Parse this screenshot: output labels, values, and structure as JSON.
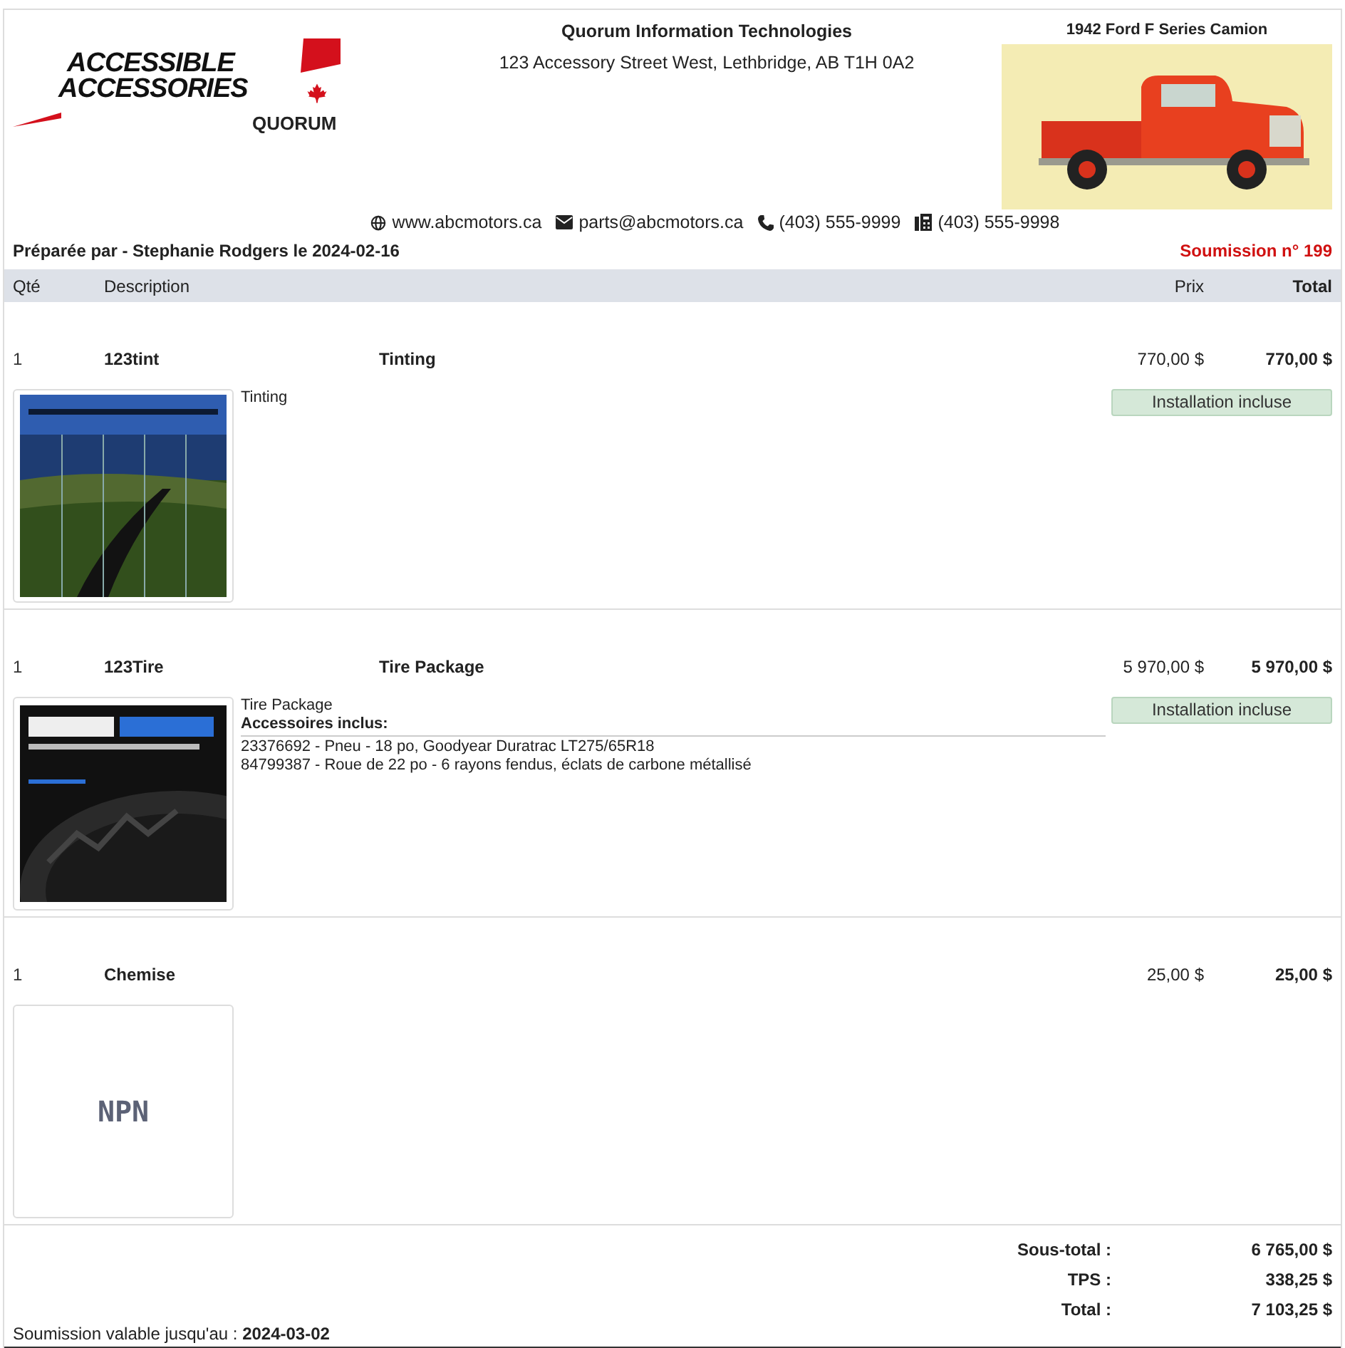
{
  "logo": {
    "line_1": "ACCESSIBLE",
    "line_2": "ACCESSORIES",
    "byline": "QUORUM"
  },
  "company": {
    "name": "Quorum Information Technologies",
    "address": "123 Accessory Street West, Lethbridge, AB T1H 0A2"
  },
  "vehicle": {
    "title": "1942 Ford F Series Camion",
    "kind": "picture"
  },
  "contacts": [
    {
      "kind": "web",
      "text": "www.abcmotors.ca"
    },
    {
      "kind": "email",
      "text": "parts@abcmotors.ca"
    },
    {
      "kind": "phone",
      "text": "(403) 555-9999"
    },
    {
      "kind": "fax",
      "text": "(403) 555-9998"
    }
  ],
  "prepared_by": "Préparée par - Stephanie Rodgers le 2024-02-16",
  "quote_number": "Soumission n° 199",
  "columns": {
    "qty": "Qté",
    "description": "Description",
    "price": "Prix",
    "total": "Total"
  },
  "items": [
    {
      "qty": "1",
      "code": "123tint",
      "name": "Tinting",
      "price": "770,00 $",
      "total": "770,00 $",
      "description": "Tinting",
      "badge": "Installation incluse",
      "kind": "picture"
    },
    {
      "qty": "1",
      "code": "123Tire",
      "name": "Tire Package",
      "price": "5 970,00 $",
      "total": "5 970,00 $",
      "description": "Tire Package",
      "accessories_label": "Accessoires inclus:",
      "accessories": [
        "23376692 - Pneu - 18 po, Goodyear Duratrac LT275/65R18",
        "84799387 - Roue de 22 po - 6 rayons fendus, éclats de carbone métallisé"
      ],
      "badge": "Installation incluse",
      "kind": "picture"
    },
    {
      "qty": "1",
      "code": "Chemise",
      "price": "25,00 $",
      "total": "25,00 $",
      "placeholder_text": "NPN"
    }
  ],
  "totals": [
    {
      "label": "Sous-total :",
      "value": "6 765,00 $"
    },
    {
      "label": "TPS :",
      "value": "338,25 $"
    },
    {
      "label": "Total :",
      "value": "7 103,25 $"
    }
  ],
  "validity": "Soumission valable jusqu'au : **2024-03-02**"
}
